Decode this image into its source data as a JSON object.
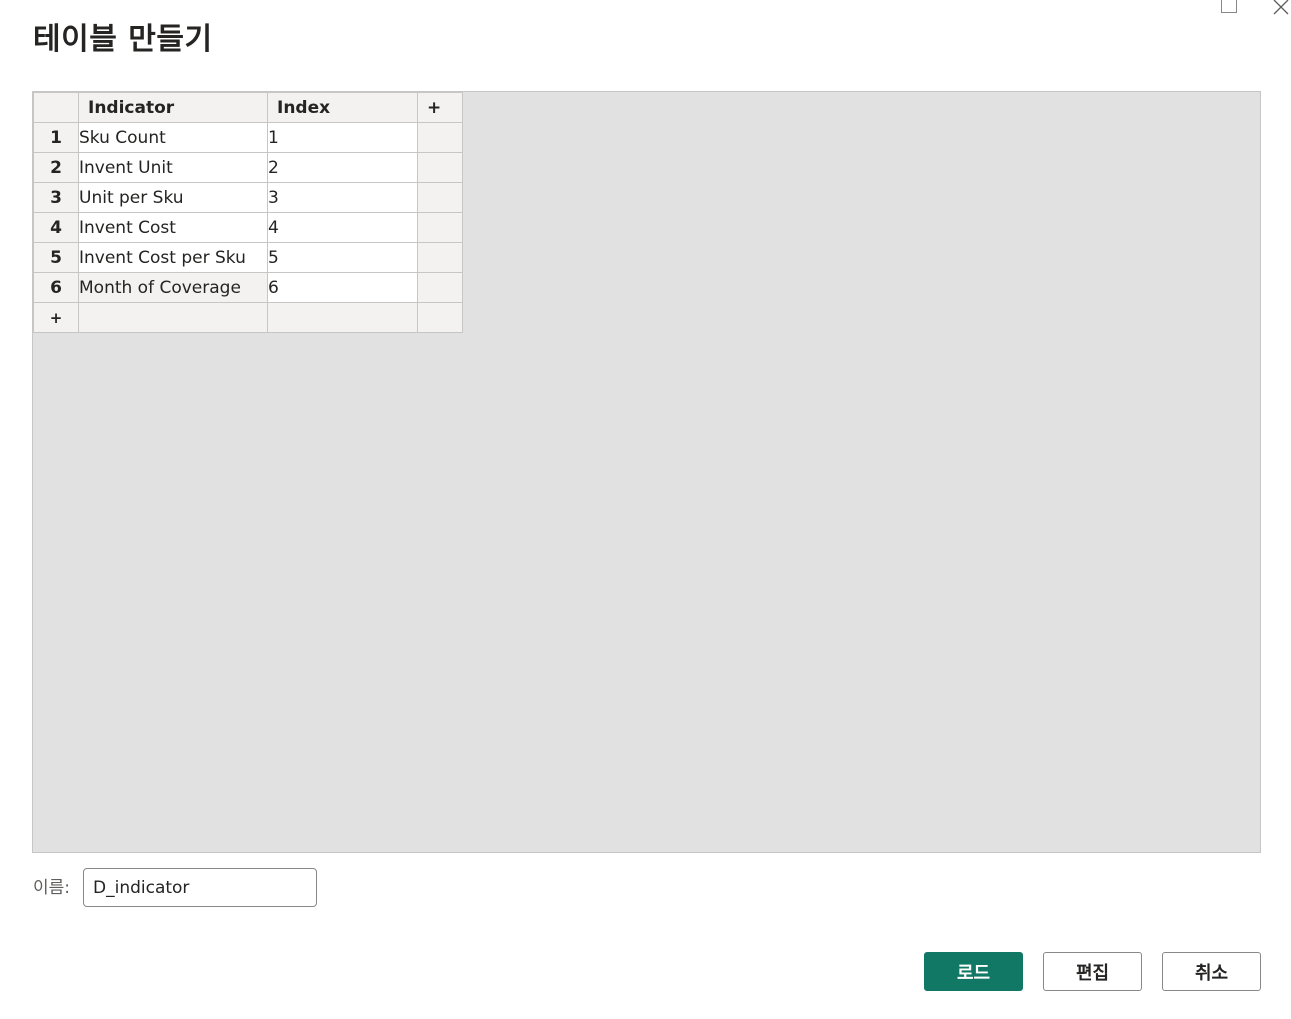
{
  "dialog": {
    "title": "테이블 만들기"
  },
  "grid": {
    "add_column_label": "+",
    "add_row_label": "+",
    "columns": [
      "Indicator",
      "Index"
    ],
    "rows": [
      {
        "num": "1",
        "indicator": "Sku Count",
        "index": "1"
      },
      {
        "num": "2",
        "indicator": "Invent Unit",
        "index": "2"
      },
      {
        "num": "3",
        "indicator": "Unit per Sku",
        "index": "3"
      },
      {
        "num": "4",
        "indicator": "Invent Cost",
        "index": "4"
      },
      {
        "num": "5",
        "indicator": "Invent Cost per Sku",
        "index": "5"
      },
      {
        "num": "6",
        "indicator": "Month of Coverage",
        "index": "6"
      }
    ]
  },
  "name_field": {
    "label": "이름:",
    "value": "D_indicator"
  },
  "buttons": {
    "load": "로드",
    "edit": "편집",
    "cancel": "취소"
  },
  "colors": {
    "accent": "#117865",
    "grid_background": "#e1e1e1",
    "header_background": "#f3f2f1"
  },
  "icons": [
    "maximize-icon",
    "close-icon"
  ]
}
